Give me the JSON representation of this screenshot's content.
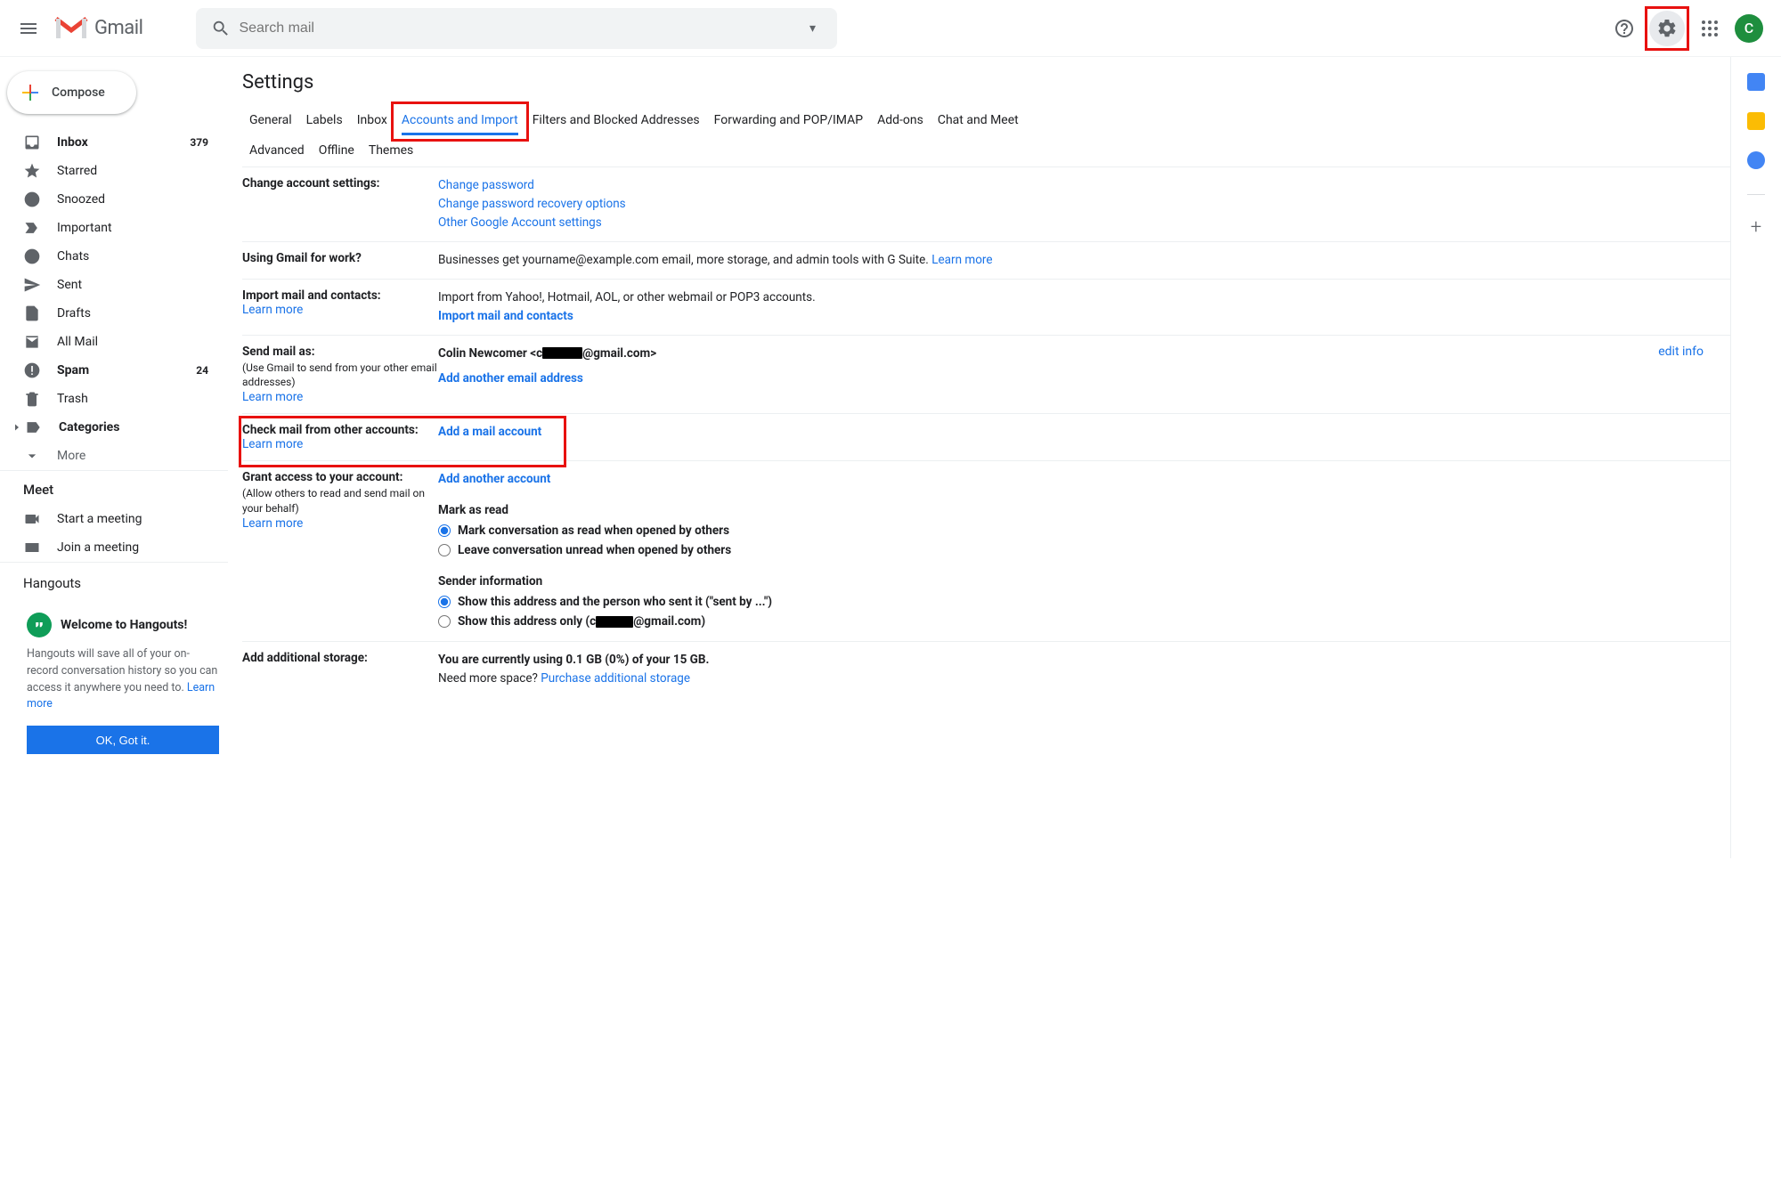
{
  "header": {
    "app_name": "Gmail",
    "search_placeholder": "Search mail",
    "avatar_letter": "C"
  },
  "sidebar": {
    "compose": "Compose",
    "items": [
      {
        "label": "Inbox",
        "count": "379",
        "bold": true
      },
      {
        "label": "Starred"
      },
      {
        "label": "Snoozed"
      },
      {
        "label": "Important"
      },
      {
        "label": "Chats"
      },
      {
        "label": "Sent"
      },
      {
        "label": "Drafts"
      },
      {
        "label": "All Mail"
      },
      {
        "label": "Spam",
        "count": "24",
        "bold": true
      },
      {
        "label": "Trash"
      },
      {
        "label": "Categories",
        "bold": true
      },
      {
        "label": "More"
      }
    ],
    "meet_header": "Meet",
    "meet_items": [
      "Start a meeting",
      "Join a meeting"
    ],
    "hangouts_header": "Hangouts",
    "hangouts_card_title": "Welcome to Hangouts!",
    "hangouts_card_text": "Hangouts will save all of your on-record conversation history so you can access it anywhere you need to. ",
    "hangouts_learn": "Learn more",
    "hangouts_btn": "OK, Got it."
  },
  "main": {
    "title": "Settings",
    "tabs_row1": [
      "General",
      "Labels",
      "Inbox",
      "Accounts and Import",
      "Filters and Blocked Addresses",
      "Forwarding and POP/IMAP",
      "Add-ons",
      "Chat and Meet"
    ],
    "tabs_row2": [
      "Advanced",
      "Offline",
      "Themes"
    ],
    "active_tab": "Accounts and Import",
    "rows": {
      "change_acct": {
        "label": "Change account settings:",
        "links": [
          "Change password",
          "Change password recovery options",
          "Other Google Account settings"
        ]
      },
      "work": {
        "label": "Using Gmail for work?",
        "text": "Businesses get yourname@example.com email, more storage, and admin tools with G Suite. ",
        "learn": "Learn more"
      },
      "import": {
        "label": "Import mail and contacts:",
        "learn": "Learn more",
        "text": "Import from Yahoo!, Hotmail, AOL, or other webmail or POP3 accounts.",
        "link": "Import mail and contacts"
      },
      "send_as": {
        "label": "Send mail as:",
        "sub": "(Use Gmail to send from your other email addresses)",
        "learn": "Learn more",
        "name": "Colin Newcomer <c",
        "email_tail": "@gmail.com>",
        "add": "Add another email address",
        "edit": "edit info"
      },
      "check_mail": {
        "label": "Check mail from other accounts:",
        "learn": "Learn more",
        "link": "Add a mail account"
      },
      "grant": {
        "label": "Grant access to your account:",
        "sub": "(Allow others to read and send mail on your behalf)",
        "learn": "Learn more",
        "add": "Add another account",
        "mark_head": "Mark as read",
        "opt1": "Mark conversation as read when opened by others",
        "opt2": "Leave conversation unread when opened by others",
        "sender_head": "Sender information",
        "sopt1": "Show this address and the person who sent it (\"sent by ...\")",
        "sopt2_a": "Show this address only (c",
        "sopt2_b": "@gmail.com)"
      },
      "storage": {
        "label": "Add additional storage:",
        "text": "You are currently using 0.1 GB (0%) of your 15 GB.",
        "text2": "Need more space? ",
        "link": "Purchase additional storage"
      }
    }
  }
}
